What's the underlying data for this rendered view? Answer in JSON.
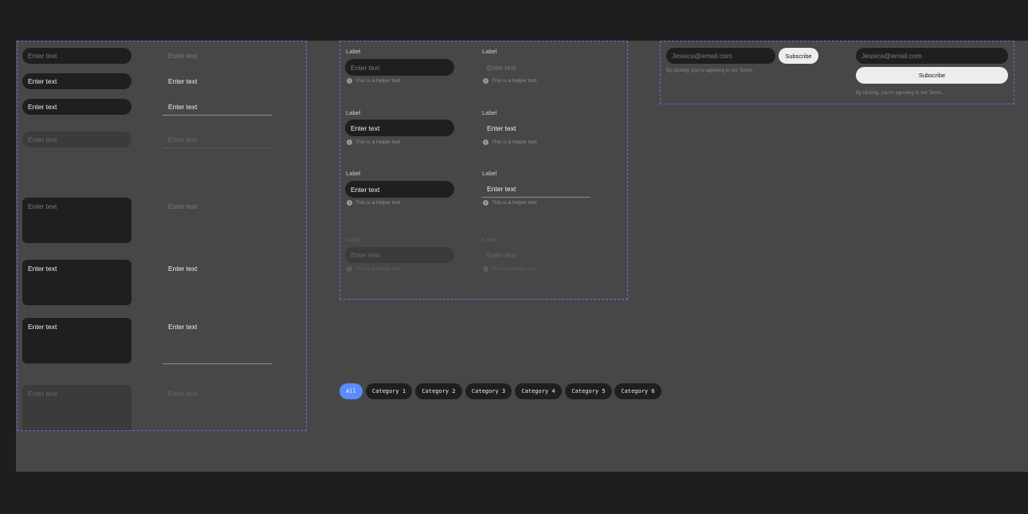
{
  "inputs": {
    "placeholder": "Enter text",
    "value": "Enter text",
    "label": "Label",
    "helper": "This is a helper text",
    "info_icon_glyph": "i"
  },
  "subscribe": {
    "email_placeholder": "Jessica@email.com",
    "button_label": "Subscribe",
    "terms": "By clicking, you're agreeing to our Terms."
  },
  "categories": {
    "items": [
      "All",
      "Category 1",
      "Category 2",
      "Category 3",
      "Category 4",
      "Category 5",
      "Category 6"
    ],
    "active_index": 0,
    "active_color": "#5b8cff"
  },
  "colors": {
    "canvas": "#474747",
    "background": "#1e1e1e",
    "frame_border": "#8a5cd6",
    "field_dark": "#1f1f1f"
  }
}
